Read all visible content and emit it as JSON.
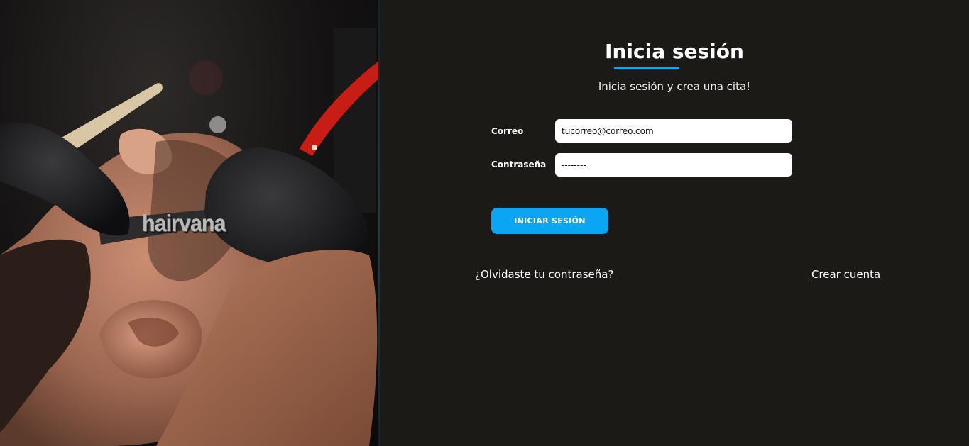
{
  "brand": {
    "logo_text": "hairvana"
  },
  "photo": {
    "description_icon": "barber-shaving-photo"
  },
  "login": {
    "title": "Inicia sesión",
    "subtitle": "Inicia sesión y crea una cita!",
    "email": {
      "label": "Correo",
      "value": "tucorreo@correo.com"
    },
    "password": {
      "label": "Contraseña",
      "value": "--------"
    },
    "submit_label": "INICIAR SESIÓN",
    "forgot_link": "¿Olvidaste tu contraseña?",
    "create_link": "Crear cuenta"
  },
  "colors": {
    "background": "#1b1a16",
    "accent": "#0aa6f3",
    "text": "#ffffff"
  }
}
